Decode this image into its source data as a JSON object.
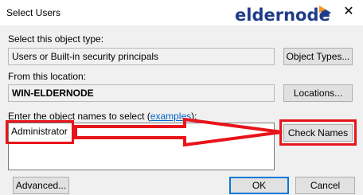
{
  "window": {
    "title": "Select Users",
    "logo_text": "eldernode"
  },
  "object_type": {
    "label": "Select this object type:",
    "value": "Users or Built-in security principals",
    "button": "Object Types..."
  },
  "location": {
    "label": "From this location:",
    "value": "WIN-ELDERNODE",
    "button": "Locations..."
  },
  "names": {
    "label_prefix": "Enter the object names to select (",
    "label_link": "examples",
    "label_suffix": "):",
    "value": "Administrator",
    "button": "Check Names"
  },
  "footer": {
    "advanced": "Advanced...",
    "ok": "OK",
    "cancel": "Cancel"
  },
  "colors": {
    "annotation": "#e8141b",
    "logo_blue": "#1f3c88",
    "logo_orange": "#f7941d"
  }
}
